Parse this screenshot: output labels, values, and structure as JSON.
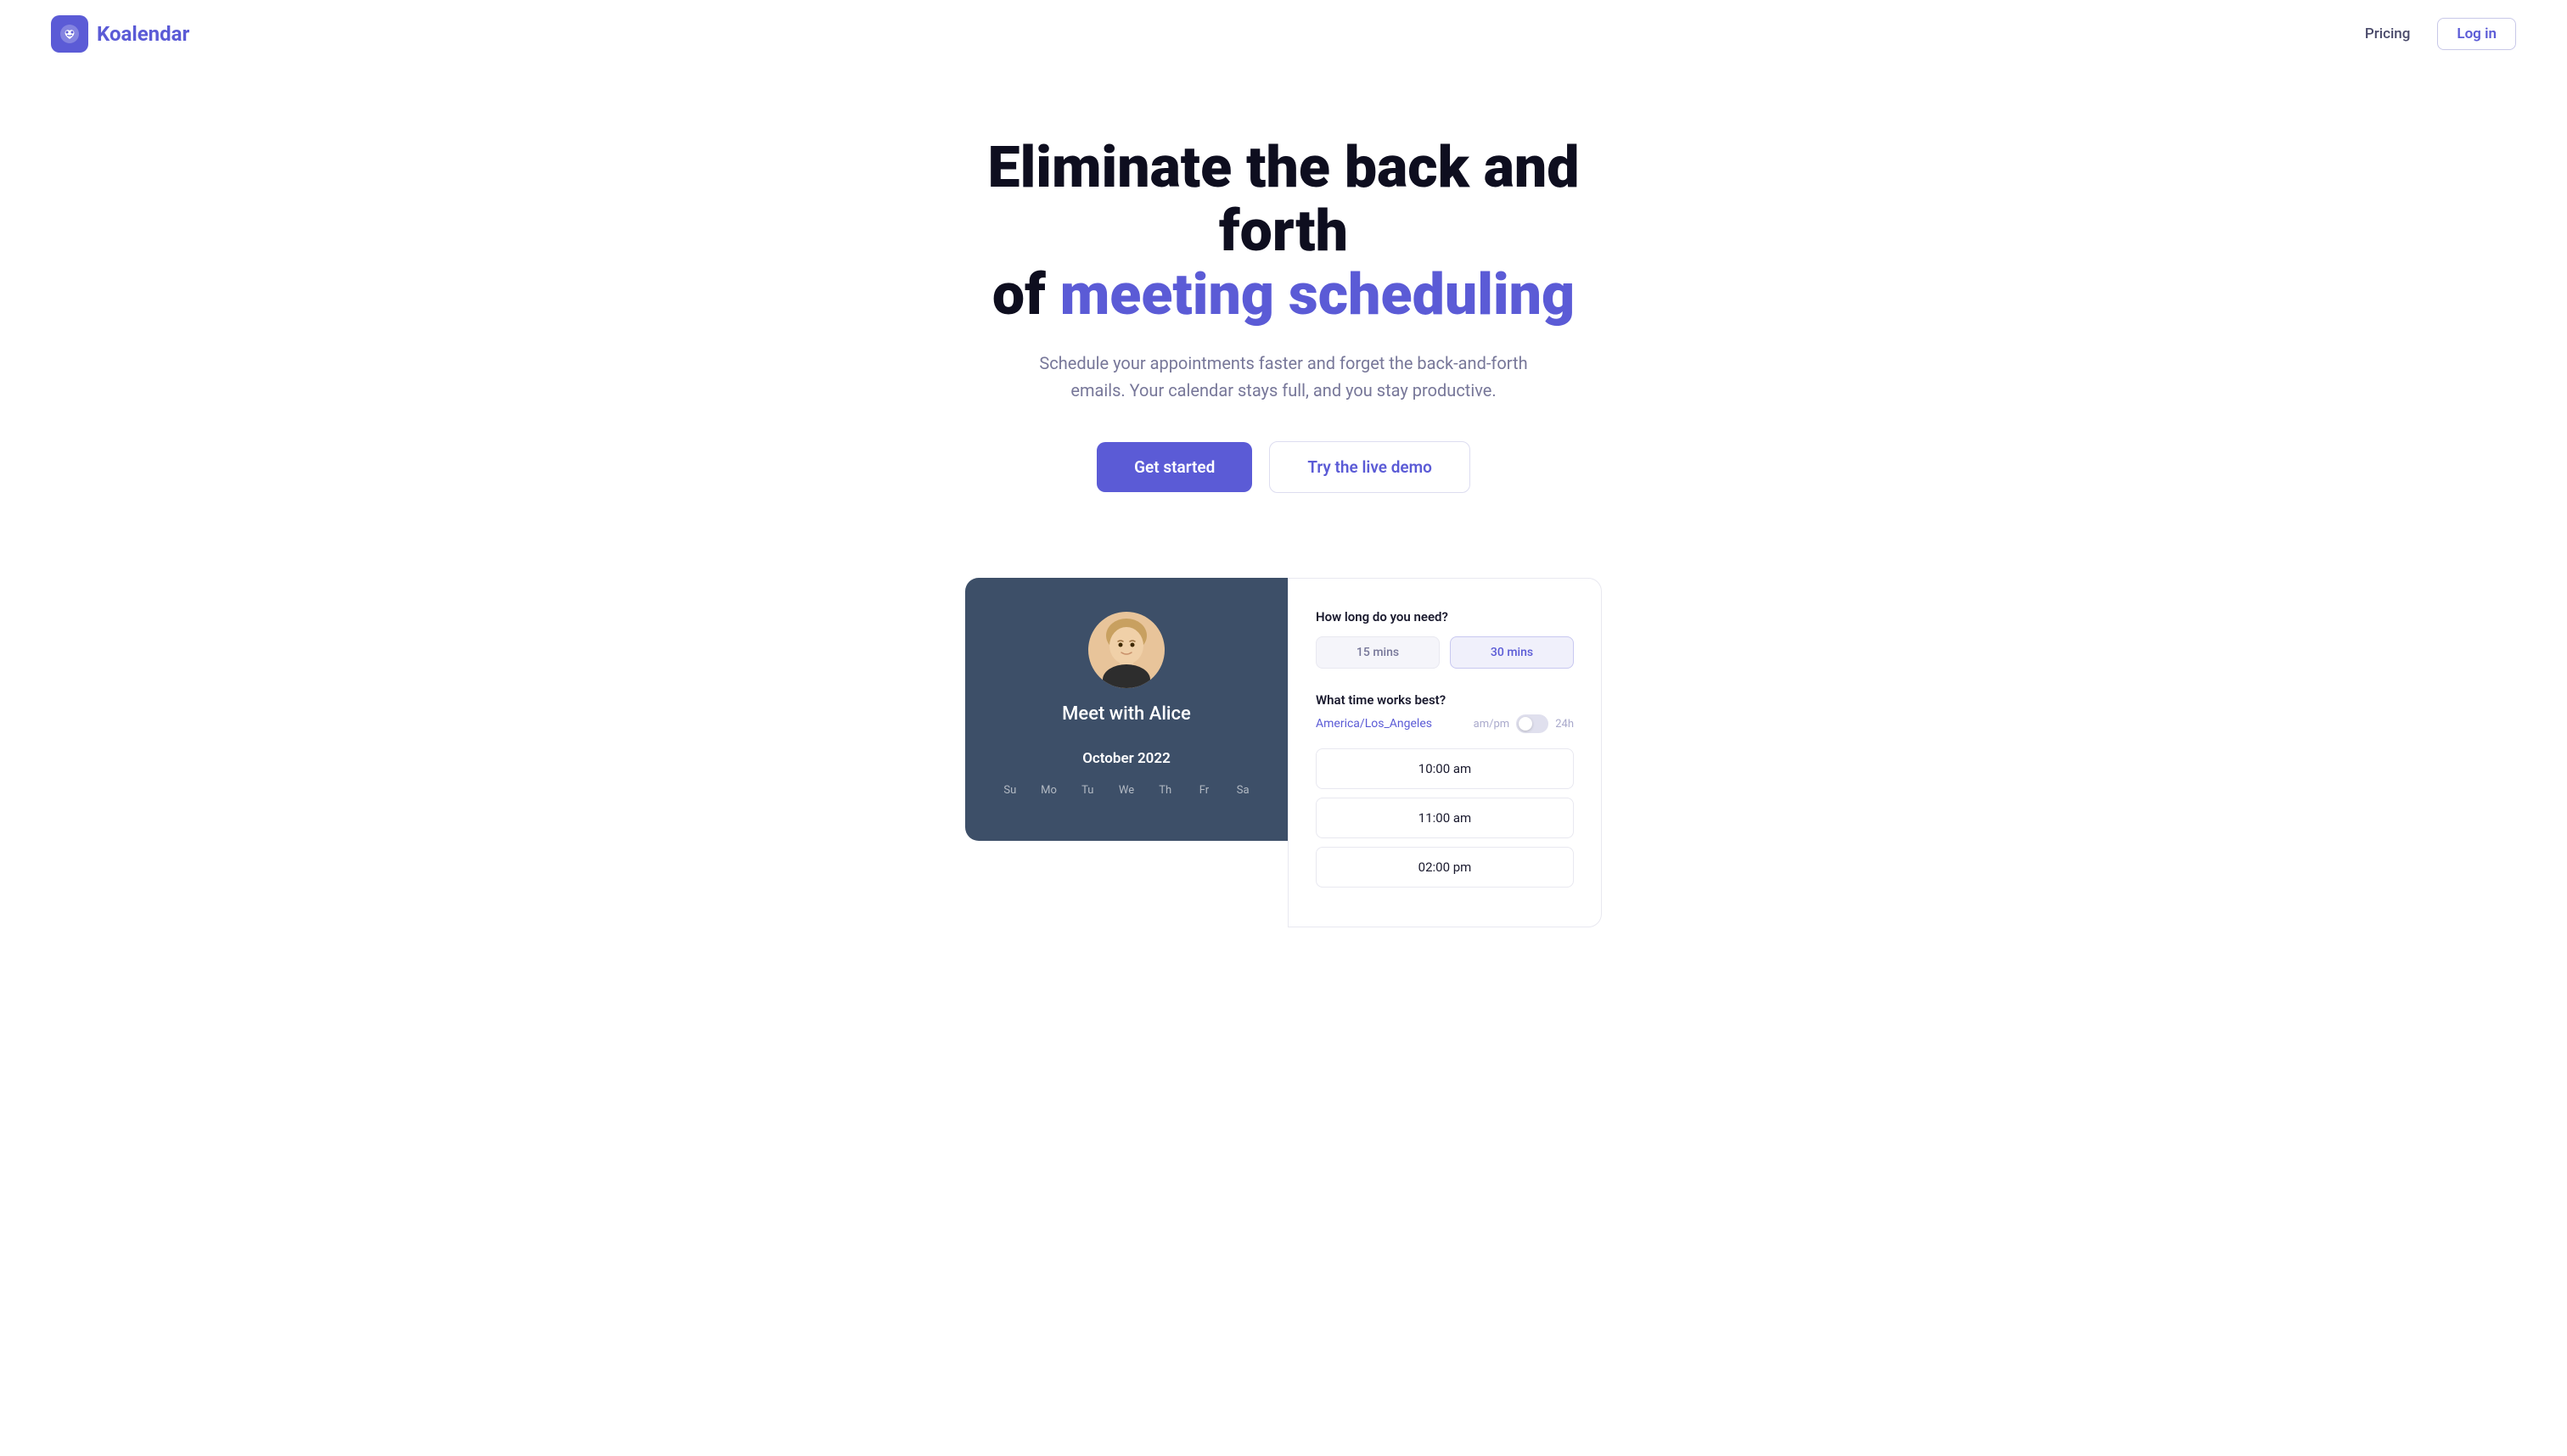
{
  "navbar": {
    "logo_brand": "Koal",
    "logo_highlight": "endar",
    "pricing_label": "Pricing",
    "login_label": "Log in"
  },
  "hero": {
    "title_line1": "Eliminate the back and forth",
    "title_line2_plain": "of ",
    "title_line2_highlight": "meeting scheduling",
    "subtitle": "Schedule your appointments faster and forget the back-and-forth emails. Your calendar stays full, and you stay productive.",
    "btn_primary": "Get started",
    "btn_secondary": "Try the live demo"
  },
  "demo": {
    "calendar": {
      "meet_label": "Meet with Alice",
      "month_label": "October 2022",
      "weekdays": [
        "Su",
        "Mo",
        "Tu",
        "We",
        "Th",
        "Fr",
        "Sa"
      ]
    },
    "booking": {
      "duration_label": "How long do you need?",
      "duration_options": [
        {
          "label": "15 mins",
          "active": false
        },
        {
          "label": "30 mins",
          "active": true
        }
      ],
      "time_label": "What time works best?",
      "timezone": "America/Los_Angeles",
      "toggle_ampm": "am/pm",
      "toggle_24h": "24h",
      "time_slots": [
        "10:00 am",
        "11:00 am",
        "02:00 pm"
      ]
    }
  }
}
